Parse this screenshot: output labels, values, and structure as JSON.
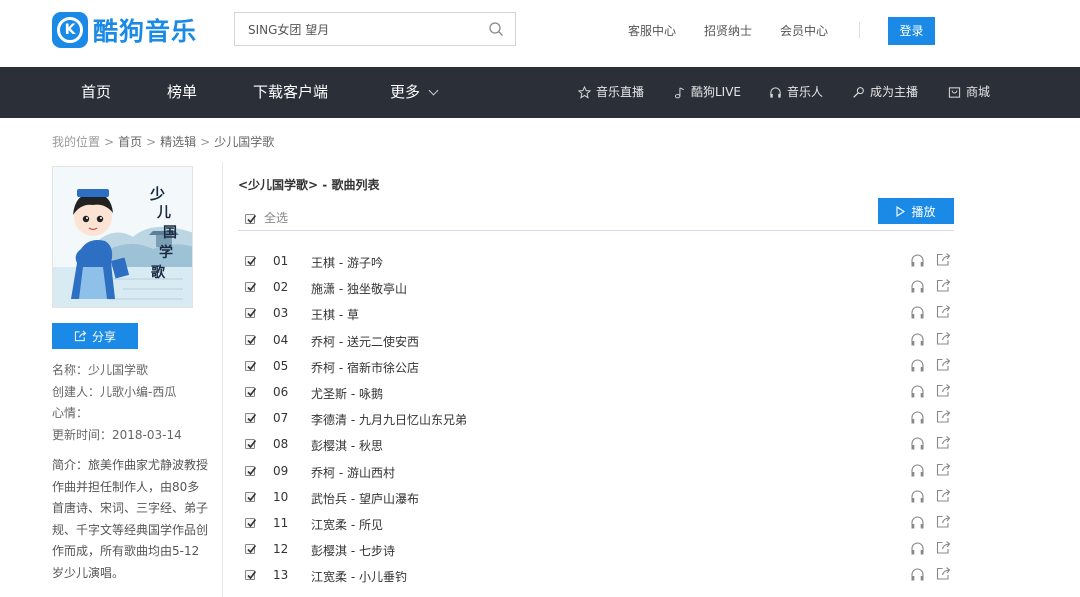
{
  "header": {
    "logo_text": "酷狗音乐",
    "logo_mark": "K",
    "search_value": "SING女团 望月",
    "links": [
      "客服中心",
      "招贤纳士",
      "会员中心"
    ],
    "login_label": "登录",
    "brand_color": "#1a8ae6"
  },
  "nav": {
    "home": "首页",
    "charts": "榜单",
    "download": "下载客户端",
    "more": "更多",
    "live": "音乐直播",
    "kugou_live": "酷狗LIVE",
    "musician": "音乐人",
    "anchor": "成为主播",
    "mall": "商城"
  },
  "breadcrumb": {
    "location": "我的位置",
    "sep": ">",
    "home": "首页",
    "picks": "精选辑",
    "current": "少儿国学歌"
  },
  "album": {
    "cover_text": "少儿国学歌",
    "share_label": "分享",
    "name_line": "名称：少儿国学歌",
    "creator_line": "创建人：儿歌小编-西瓜",
    "mood_line": "心情：",
    "updated_line": "更新时间：2018-03-14",
    "intro": "简介：旅美作曲家尤静波教授作曲并担任制作人，由80多首唐诗、宋词、三字经、弟子规、千字文等经典国学作品创作而成，所有歌曲均由5-12岁少儿演唱。"
  },
  "songlist": {
    "title": "<少儿国学歌> - 歌曲列表",
    "select_all": "全选",
    "play_label": "播放",
    "songs": [
      {
        "num": "01",
        "title": "王棋 - 游子吟"
      },
      {
        "num": "02",
        "title": "施潇 - 独坐敬亭山"
      },
      {
        "num": "03",
        "title": "王棋 - 草"
      },
      {
        "num": "04",
        "title": "乔柯 - 送元二使安西"
      },
      {
        "num": "05",
        "title": "乔柯 - 宿新市徐公店"
      },
      {
        "num": "06",
        "title": "尤圣斯 - 咏鹅"
      },
      {
        "num": "07",
        "title": "李德清 - 九月九日忆山东兄弟"
      },
      {
        "num": "08",
        "title": "彭樱淇 - 秋思"
      },
      {
        "num": "09",
        "title": "乔柯 - 游山西村"
      },
      {
        "num": "10",
        "title": "武怡兵 - 望庐山瀑布"
      },
      {
        "num": "11",
        "title": "江宽柔 - 所见"
      },
      {
        "num": "12",
        "title": "彭樱淇 - 七步诗"
      },
      {
        "num": "13",
        "title": "江宽柔 - 小儿垂钓"
      }
    ]
  }
}
